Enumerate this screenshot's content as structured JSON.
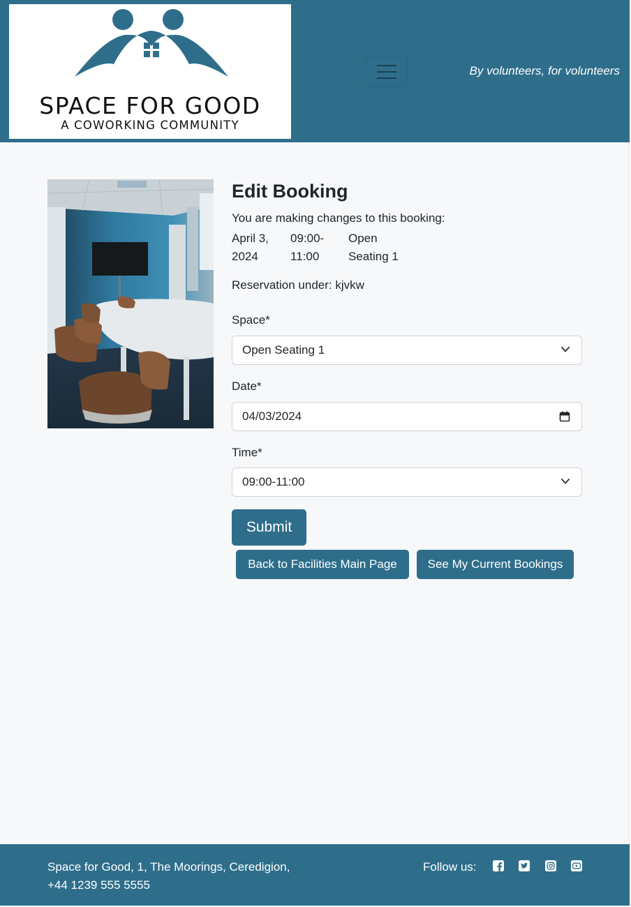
{
  "header": {
    "logo_title": "SPACE FOR GOOD",
    "logo_subtitle": "A COWORKING COMMUNITY",
    "tagline": "By volunteers, for volunteers",
    "menu_icon": "hamburger-icon",
    "brand_color": "#2e6e8b"
  },
  "main": {
    "image_alt": "meeting room",
    "title": "Edit Booking",
    "intro": "You are making changes to this booking:",
    "booking": {
      "date_line1": "April 3,",
      "date_line2": "2024",
      "time_line1": "09:00-",
      "time_line2": "11:00",
      "space_line1": "Open",
      "space_line2": "Seating 1"
    },
    "reservation": "Reservation under: kjvkw",
    "form": {
      "space_label": "Space*",
      "space_value": "Open Seating 1",
      "date_label": "Date*",
      "date_value": "04/03/2024",
      "time_label": "Time*",
      "time_value": "09:00-11:00",
      "submit_label": "Submit"
    },
    "back_label": "Back to Facilities Main Page",
    "bookings_label": "See My Current Bookings"
  },
  "footer": {
    "address_line1": "Space for Good, 1, The Moorings, Ceredigion,",
    "address_line2": "+44 1239 555 5555",
    "follow_label": "Follow us:",
    "social_icons": [
      "facebook-icon",
      "twitter-icon",
      "instagram-icon",
      "youtube-icon"
    ]
  }
}
